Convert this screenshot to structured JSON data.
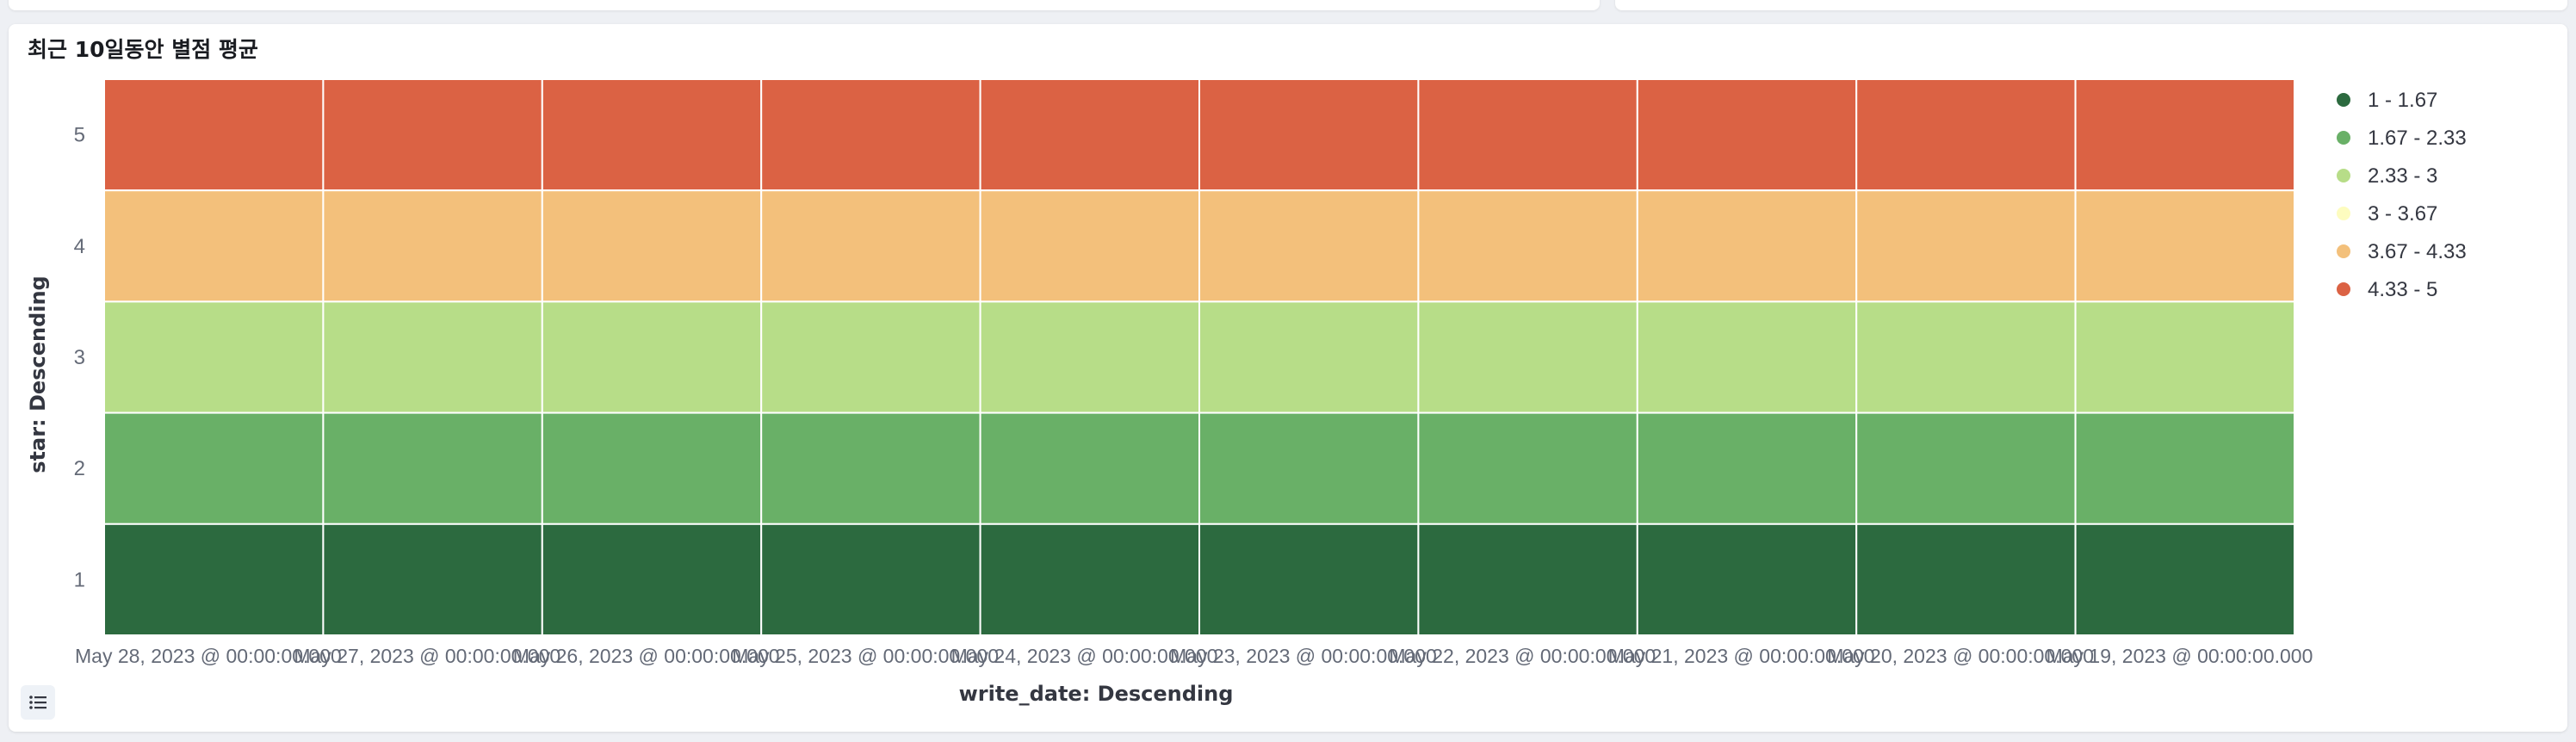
{
  "panel": {
    "title": "최근 10일동안 별점 평균"
  },
  "chart_data": {
    "type": "heatmap",
    "title": "최근 10일동안 별점 평균",
    "xlabel": "write_date: Descending",
    "ylabel": "star: Descending",
    "x_categories": [
      "May 28, 2023 @ 00:00:00.000",
      "May 27, 2023 @ 00:00:00.000",
      "May 26, 2023 @ 00:00:00.000",
      "May 25, 2023 @ 00:00:00.000",
      "May 24, 2023 @ 00:00:00.000",
      "May 23, 2023 @ 00:00:00.000",
      "May 22, 2023 @ 00:00:00.000",
      "May 21, 2023 @ 00:00:00.000",
      "May 20, 2023 @ 00:00:00.000",
      "May 19, 2023 @ 00:00:00.000"
    ],
    "y_categories": [
      "5",
      "4",
      "3",
      "2",
      "1"
    ],
    "values": [
      [
        5,
        5,
        5,
        5,
        5,
        5,
        5,
        5,
        5,
        5
      ],
      [
        4,
        4,
        4,
        4,
        4,
        4,
        4,
        4,
        4,
        4
      ],
      [
        3,
        3,
        3,
        3,
        3,
        3,
        3,
        3,
        3,
        3
      ],
      [
        2,
        2,
        2,
        2,
        2,
        2,
        2,
        2,
        2,
        2
      ],
      [
        1,
        1,
        1,
        1,
        1,
        1,
        1,
        1,
        1,
        1
      ]
    ],
    "color_bands": [
      {
        "label": "1 - 1.67",
        "min": 1,
        "max": 1.67,
        "color": "#2c6a3f"
      },
      {
        "label": "1.67 - 2.33",
        "min": 1.67,
        "max": 2.33,
        "color": "#69b067"
      },
      {
        "label": "2.33 - 3",
        "min": 2.33,
        "max": 3,
        "color": "#b7dd88"
      },
      {
        "label": "3 - 3.67",
        "min": 3,
        "max": 3.67,
        "color": "#fdfcbf"
      },
      {
        "label": "3.67 - 4.33",
        "min": 3.67,
        "max": 4.33,
        "color": "#f3c07b"
      },
      {
        "label": "4.33 - 5",
        "min": 4.33,
        "max": 5,
        "color": "#db6244"
      }
    ],
    "legend_position": "right",
    "grid": false
  }
}
